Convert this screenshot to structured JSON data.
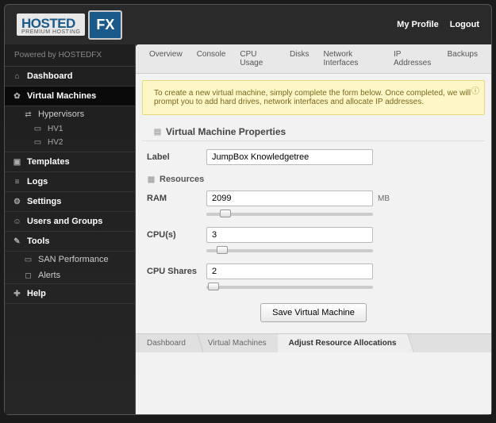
{
  "header": {
    "logo_top": "HOSTED",
    "logo_bottom": "PREMIUM HOSTING",
    "logo_fx": "FX",
    "my_profile": "My Profile",
    "logout": "Logout"
  },
  "sidebar": {
    "powered": "Powered by  HOSTEDFX",
    "items": {
      "dashboard": "Dashboard",
      "vm": "Virtual Machines",
      "hypervisors": "Hypervisors",
      "hv1": "HV1",
      "hv2": "HV2",
      "templates": "Templates",
      "logs": "Logs",
      "settings": "Settings",
      "users": "Users and Groups",
      "tools": "Tools",
      "san": "SAN Performance",
      "alerts": "Alerts",
      "help": "Help"
    }
  },
  "tabs": {
    "overview": "Overview",
    "console": "Console",
    "cpu": "CPU Usage",
    "disks": "Disks",
    "net": "Network Interfaces",
    "ip": "IP Addresses",
    "backups": "Backups"
  },
  "notice": "To create a new virtual machine, simply complete the form below. Once completed, we will prompt you to add hard drives, network interfaces and allocate IP addresses.",
  "section": {
    "properties": "Virtual Machine Properties",
    "resources": "Resources"
  },
  "form": {
    "label_label": "Label",
    "label_value": "JumpBox Knowledgetree",
    "ram_label": "RAM",
    "ram_value": "2099",
    "ram_unit": "MB",
    "cpu_label": "CPU(s)",
    "cpu_value": "3",
    "cpushares_label": "CPU Shares",
    "cpushares_value": "2",
    "save": "Save Virtual Machine"
  },
  "breadcrumb": {
    "dashboard": "Dashboard",
    "vm": "Virtual Machines",
    "adjust": "Adjust Resource Allocations"
  },
  "sliders": {
    "ram_pos": "8%",
    "cpu_pos": "6%",
    "shares_pos": "1%"
  }
}
